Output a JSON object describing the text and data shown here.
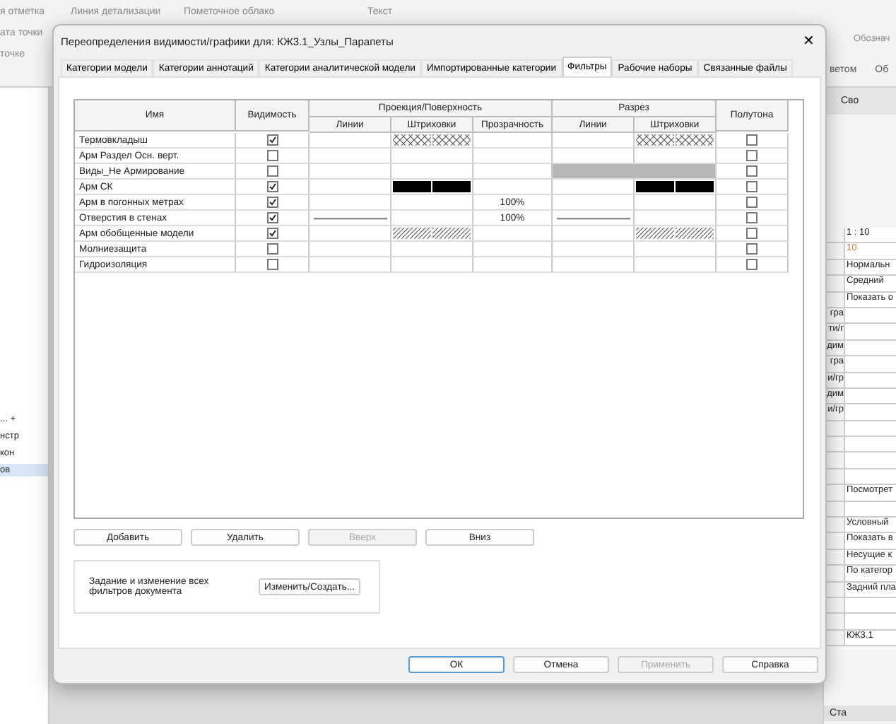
{
  "app": {
    "ribbon": {
      "columns": [
        [
          "я отметка",
          "ата точки",
          "точке"
        ],
        [
          "Линия детализации"
        ],
        [
          "Пометочное облако"
        ],
        [
          "Текст"
        ]
      ],
      "right_label": "Обознач",
      "panel_labels": [
        "ветом",
        "Об"
      ]
    },
    "left_panel": {
      "items": [
        {
          "label": "... +",
          "selected": false
        },
        {
          "label": "нстр",
          "selected": false
        },
        {
          "label": "кон",
          "selected": false
        },
        {
          "label": "ов",
          "selected": true
        }
      ]
    },
    "properties": {
      "header": "Сво",
      "rows": [
        {
          "label": "",
          "value": "1 : 10"
        },
        {
          "label": "",
          "value": "10"
        },
        {
          "label": "",
          "value": "Нормальн"
        },
        {
          "label": "",
          "value": "Средний"
        },
        {
          "label": "",
          "value": "Показать о"
        },
        {
          "label": "гра",
          "value": ""
        },
        {
          "label": "ти/г",
          "value": ""
        },
        {
          "label": "дим",
          "value": ""
        },
        {
          "label": "гра",
          "value": ""
        },
        {
          "label": "и/гр",
          "value": ""
        },
        {
          "label": "дим",
          "value": ""
        },
        {
          "label": "и/гр",
          "value": ""
        },
        {
          "label": "",
          "value": ""
        },
        {
          "label": "",
          "value": ""
        },
        {
          "label": "",
          "value": ""
        },
        {
          "label": "",
          "value": ""
        },
        {
          "label": "",
          "value": "Посмотрет"
        },
        {
          "label": "",
          "value": ""
        },
        {
          "label": "",
          "value": "Условный"
        },
        {
          "label": "",
          "value": "Показать в"
        },
        {
          "label": "",
          "value": "Несущие к"
        },
        {
          "label": "",
          "value": "По категор"
        },
        {
          "label": "",
          "value": "Задний пла"
        },
        {
          "label": "",
          "value": ""
        },
        {
          "label": "",
          "value": ""
        },
        {
          "label": "",
          "value": "КЖ3.1"
        }
      ],
      "footer": "Ста"
    }
  },
  "dialog": {
    "title": "Переопределения видимости/графики для: КЖ3.1_Узлы_Парапеты",
    "close": "✕",
    "tabs": [
      {
        "label": "Категории модели",
        "selected": false
      },
      {
        "label": "Категории аннотаций",
        "selected": false
      },
      {
        "label": "Категории аналитической модели",
        "selected": false
      },
      {
        "label": "Импортированные категории",
        "selected": false
      },
      {
        "label": "Фильтры",
        "selected": true
      },
      {
        "label": "Рабочие наборы",
        "selected": false
      },
      {
        "label": "Связанные файлы",
        "selected": false
      }
    ],
    "table": {
      "col_name": "Имя",
      "col_visibility": "Видимость",
      "group_projection": "Проекция/Поверхность",
      "group_cut": "Разрез",
      "col_halftone": "Полутона",
      "sub_lines": "Линии",
      "sub_hatch": "Штриховки",
      "sub_transparency": "Прозрачность",
      "sub_cut_lines": "Линии",
      "sub_cut_hatch": "Штриховки",
      "rows": [
        {
          "name": "Термовкладыш",
          "visible": true,
          "halftone": false,
          "proj_line": {
            "kind": "none"
          },
          "proj_hatch": {
            "kind": "crosshatch"
          },
          "transparency": "",
          "cut_line": {
            "kind": "none"
          },
          "cut_hatch": {
            "kind": "crosshatch"
          },
          "cut_disabled": false
        },
        {
          "name": "Арм Раздел Осн. верт.",
          "visible": false,
          "halftone": false,
          "proj_line": {
            "kind": "none"
          },
          "proj_hatch": {
            "kind": "none"
          },
          "transparency": "",
          "cut_line": {
            "kind": "none"
          },
          "cut_hatch": {
            "kind": "none"
          },
          "cut_disabled": false
        },
        {
          "name": "Виды_Не Армирование",
          "visible": false,
          "halftone": false,
          "proj_line": {
            "kind": "none"
          },
          "proj_hatch": {
            "kind": "none"
          },
          "transparency": "",
          "cut_disabled": true
        },
        {
          "name": "Арм СК",
          "visible": true,
          "halftone": false,
          "proj_line": {
            "kind": "none"
          },
          "proj_hatch": {
            "kind": "solid"
          },
          "transparency": "",
          "cut_line": {
            "kind": "none"
          },
          "cut_hatch": {
            "kind": "solid"
          },
          "cut_disabled": false
        },
        {
          "name": "Арм в погонных метрах",
          "visible": true,
          "halftone": false,
          "proj_line": {
            "kind": "none"
          },
          "proj_hatch": {
            "kind": "none"
          },
          "transparency": "100%",
          "cut_line": {
            "kind": "none"
          },
          "cut_hatch": {
            "kind": "none"
          },
          "cut_disabled": false
        },
        {
          "name": "Отверстия в стенах",
          "visible": true,
          "halftone": false,
          "proj_line": {
            "kind": "line"
          },
          "proj_hatch": {
            "kind": "none"
          },
          "transparency": "100%",
          "cut_line": {
            "kind": "line"
          },
          "cut_hatch": {
            "kind": "none"
          },
          "cut_disabled": false
        },
        {
          "name": "Арм обобщенные модели",
          "visible": true,
          "halftone": false,
          "proj_line": {
            "kind": "none"
          },
          "proj_hatch": {
            "kind": "diagonal"
          },
          "transparency": "",
          "cut_line": {
            "kind": "none"
          },
          "cut_hatch": {
            "kind": "diagonal"
          },
          "cut_disabled": false
        },
        {
          "name": "Молниезащита",
          "visible": false,
          "halftone": false,
          "proj_line": {
            "kind": "none"
          },
          "proj_hatch": {
            "kind": "none"
          },
          "transparency": "",
          "cut_line": {
            "kind": "none"
          },
          "cut_hatch": {
            "kind": "none"
          },
          "cut_disabled": false
        },
        {
          "name": "Гидроизоляция",
          "visible": false,
          "halftone": false,
          "proj_line": {
            "kind": "none"
          },
          "proj_hatch": {
            "kind": "none"
          },
          "transparency": "",
          "cut_line": {
            "kind": "none"
          },
          "cut_hatch": {
            "kind": "none"
          },
          "cut_disabled": false
        }
      ]
    },
    "row_buttons": [
      {
        "label": "Добавить",
        "disabled": false
      },
      {
        "label": "Удалить",
        "disabled": false
      },
      {
        "label": "Вверх",
        "disabled": true
      },
      {
        "label": "Вниз",
        "disabled": false
      }
    ],
    "filters_group": {
      "text": "Задание и изменение всех фильтров документа",
      "button": "Изменить/Создать..."
    },
    "footer_buttons": [
      {
        "label": "ОК",
        "disabled": false,
        "default": true
      },
      {
        "label": "Отмена",
        "disabled": false,
        "default": false
      },
      {
        "label": "Применить",
        "disabled": true,
        "default": false
      },
      {
        "label": "Справка",
        "disabled": false,
        "default": false
      }
    ]
  }
}
